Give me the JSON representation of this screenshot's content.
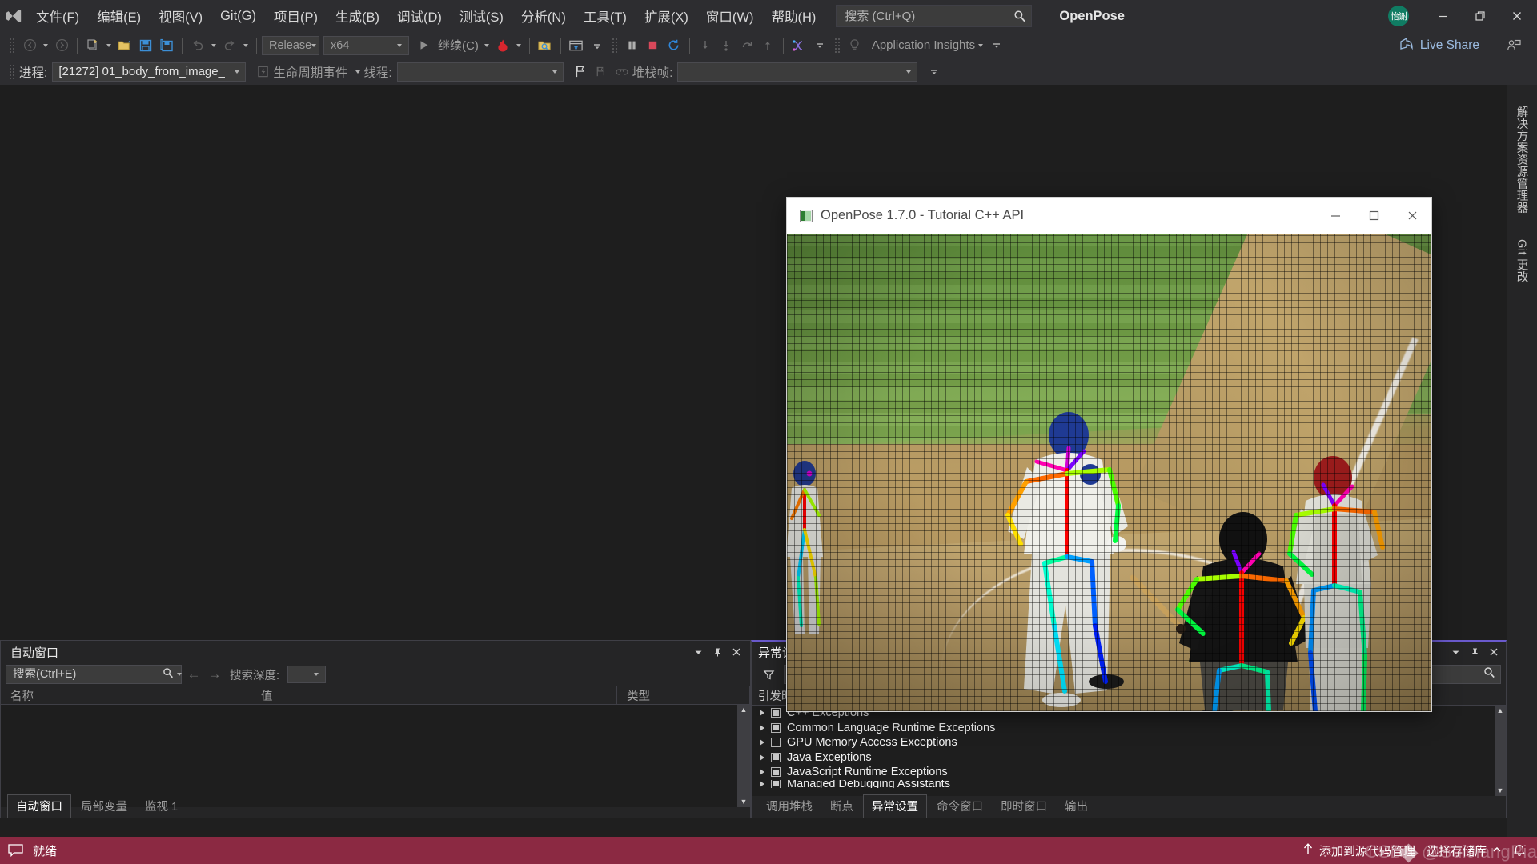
{
  "app": {
    "name": "Microsoft Visual Studio",
    "project_title": "OpenPose",
    "logo_icon": "visual-studio-logo-icon"
  },
  "menubar": {
    "items": [
      {
        "label": "文件(F)"
      },
      {
        "label": "编辑(E)"
      },
      {
        "label": "视图(V)"
      },
      {
        "label": "Git(G)"
      },
      {
        "label": "项目(P)"
      },
      {
        "label": "生成(B)"
      },
      {
        "label": "调试(D)"
      },
      {
        "label": "测试(S)"
      },
      {
        "label": "分析(N)"
      },
      {
        "label": "工具(T)"
      },
      {
        "label": "扩展(X)"
      },
      {
        "label": "窗口(W)"
      },
      {
        "label": "帮助(H)"
      }
    ],
    "search_placeholder": "搜索 (Ctrl+Q)",
    "search_value": "",
    "search_icon": "magnifier-icon"
  },
  "titlebar": {
    "account_initials": "怡谢",
    "minimize_icon": "minimize-icon",
    "restore_icon": "restore-icon",
    "close_icon": "close-icon"
  },
  "toolbar": {
    "nav_back_icon": "arrow-back-icon",
    "nav_forward_icon": "arrow-forward-icon",
    "new_item_icon": "new-item-icon",
    "open_icon": "open-folder-icon",
    "save_icon": "save-icon",
    "save_all_icon": "save-all-icon",
    "undo_icon": "undo-icon",
    "redo_icon": "redo-icon",
    "configuration": "Release",
    "platform": "x64",
    "start_icon": "play-triangle-icon",
    "start_label": "继续(C)",
    "hot_reload_icon": "hot-reload-flame-icon",
    "attach_icon": "attach-to-process-icon",
    "home_icon": "debug-window-icon",
    "pause_icon": "pause-icon",
    "stop_icon": "stop-square-icon",
    "restart_icon": "restart-circle-icon",
    "step_into_icon": "step-into-icon",
    "step_over_icon": "step-over-icon",
    "step_out_icon": "step-out-icon",
    "step_up_icon": "step-up-icon",
    "thread_icon": "threads-icon",
    "lightbulb_icon": "lightbulb-icon",
    "app_insights_label": "Application Insights",
    "overflow_icon": "toolbar-overflow-icon"
  },
  "debugbar": {
    "process_label": "进程:",
    "process_value": "[21272] 01_body_from_image_",
    "lifecycle_icon": "lifecycle-events-icon",
    "lifecycle_label": "生命周期事件",
    "thread_label": "线程:",
    "thread_value": "",
    "flag_icon": "flag-icon",
    "flags_icon": "flags-icon",
    "link_icon": "chain-link-icon",
    "stackframe_label": "堆栈帧:",
    "stackframe_value": ""
  },
  "rightrail": {
    "tabs": [
      {
        "label": "解决方案资源管理器"
      },
      {
        "label": "Git 更改"
      }
    ]
  },
  "autos_panel": {
    "title": "自动窗口",
    "dropdown_icon": "chevron-down-icon",
    "pin_icon": "pin-icon",
    "close_icon": "close-icon",
    "search_placeholder": "搜索(Ctrl+E)",
    "search_value": "",
    "search_icon": "magnifier-icon",
    "prev_icon": "arrow-left-icon",
    "next_icon": "arrow-right-icon",
    "depth_label": "搜索深度:",
    "depth_value": "",
    "columns": [
      "名称",
      "值",
      "类型"
    ],
    "rows": [],
    "tabs": [
      {
        "label": "自动窗口",
        "active": true
      },
      {
        "label": "局部变量",
        "active": false
      },
      {
        "label": "监视 1",
        "active": false
      }
    ]
  },
  "exception_panel": {
    "title": "异常设置",
    "filter_icon": "funnel-filter-icon",
    "search_value": "",
    "search_icon": "magnifier-icon",
    "column_label": "引发时中断",
    "dropdown_icon": "chevron-down-icon",
    "pin_icon": "pin-icon",
    "close_icon": "close-icon",
    "rows": [
      {
        "label": "C++ Exceptions",
        "state": "partial"
      },
      {
        "label": "Common Language Runtime Exceptions",
        "state": "partial"
      },
      {
        "label": "GPU Memory Access Exceptions",
        "state": "unchecked"
      },
      {
        "label": "Java Exceptions",
        "state": "partial"
      },
      {
        "label": "JavaScript Runtime Exceptions",
        "state": "partial"
      },
      {
        "label": "Managed Debugging Assistants",
        "state": "partial"
      }
    ],
    "tabs": [
      {
        "label": "调用堆栈",
        "active": false
      },
      {
        "label": "断点",
        "active": false
      },
      {
        "label": "异常设置",
        "active": true
      },
      {
        "label": "命令窗口",
        "active": false
      },
      {
        "label": "即时窗口",
        "active": false
      },
      {
        "label": "输出",
        "active": false
      }
    ]
  },
  "statusbar": {
    "ready_icon": "feedback-icon",
    "ready_text": "就绪",
    "upload_icon": "arrow-up-icon",
    "source_control_text": "添加到源代码管理",
    "repo_text": "选择存储库",
    "repo_icon": "chevron-up-icon",
    "notify_icon": "bell-icon",
    "color": "#8b2942"
  },
  "live_share": {
    "label": "Live Share",
    "share_icon": "share-arrow-icon",
    "person_icon": "person-share-icon"
  },
  "openpose_window": {
    "title": "OpenPose 1.7.0 - Tutorial C++ API",
    "app_icon": "openpose-icon",
    "minimize_icon": "minimize-icon",
    "maximize_icon": "maximize-icon",
    "close_icon": "close-icon",
    "image_description": "Baseball batter, umpire and catcher at home plate with OpenPose BODY_25 skeleton keypoint overlays rendered in rainbow colors, viewed through a backstop net",
    "detected_persons": 4
  },
  "watermark": {
    "text": "CSDN @SuiJiangPiaoLiu"
  }
}
